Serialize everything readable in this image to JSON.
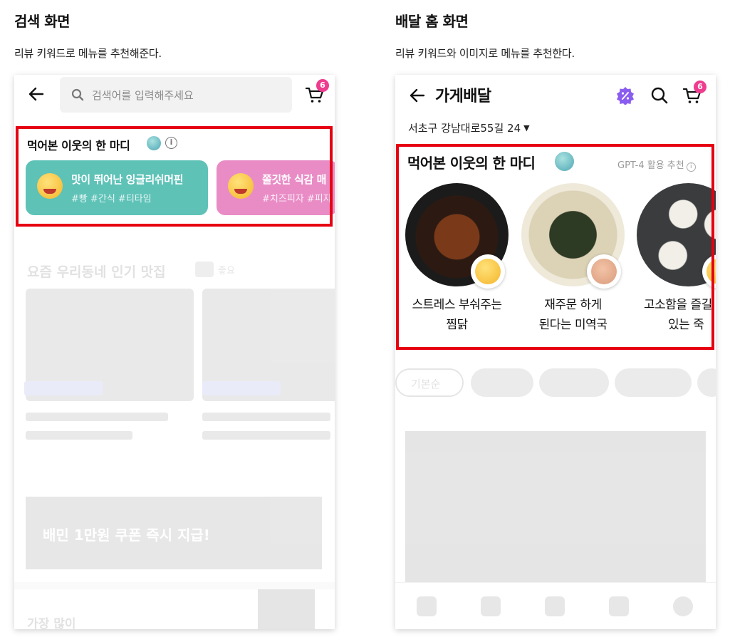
{
  "left": {
    "title": "검색 화면",
    "description": "리뷰 키워드로 메뉴를 추천해준다.",
    "search_placeholder": "검색어를 입력해주세요",
    "cart_count": "6",
    "review_section": {
      "title": "먹어본 이웃의 한 마디",
      "info_icon": "i",
      "chips": [
        {
          "title": "맛이 뛰어난 잉글리쉬머핀",
          "tags": "#빵 #간식 #티타임",
          "color": "#5ec2b7"
        },
        {
          "title": "쫄깃한 식감 매",
          "tags": "#치즈피자 #피자",
          "color": "#e98cc6"
        }
      ]
    },
    "faded": {
      "popular_title": "요즘 우리동네 인기 맛집",
      "popular_badge": "좋요",
      "banner_text": "배민 1만원 쿠폰 즉시 지급!",
      "bottom_title": "가장 많이"
    }
  },
  "right": {
    "title": "배달 홈 화면",
    "description": "리뷰 키워드와 이미지로 메뉴를 추천한다.",
    "store_title": "가게배달",
    "cart_count": "6",
    "address": "서초구 강남대로55길 24",
    "review_section": {
      "title": "먹어본 이웃의 한 마디",
      "note": "GPT-4 활용 추천",
      "dishes": [
        {
          "line1": "스트레스 부숴주는",
          "line2": "찜닭",
          "icon": "cringe-face-icon"
        },
        {
          "line1": "재주문 하게",
          "line2": "된다는 미역국",
          "icon": "rock-hand-icon"
        },
        {
          "line1": "고소함을 즐길",
          "line2": "있는 죽",
          "icon": "yellow-face-icon"
        }
      ]
    },
    "faded": {
      "sort_chip": "기본순"
    }
  },
  "colors": {
    "highlight": "#e60012",
    "badge": "#ee3c8f",
    "chip_teal": "#5ec2b7",
    "chip_pink": "#e98cc6"
  }
}
